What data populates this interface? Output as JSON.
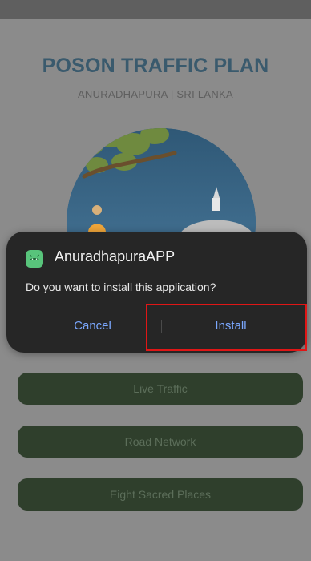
{
  "app": {
    "title": "POSON TRAFFIC PLAN",
    "subtitle": "ANURADHAPURA | SRI LANKA",
    "buttons": [
      "Live Traffic",
      "Road Network",
      "Eight Sacred Places"
    ]
  },
  "dialog": {
    "app_name": "AnuradhapuraAPP",
    "message": "Do you want to install this application?",
    "cancel_label": "Cancel",
    "install_label": "Install",
    "icon": "android-icon"
  },
  "colors": {
    "accent": "#7ba8ff",
    "dialog_bg": "#262626",
    "overlay": "#8b8b8b",
    "highlight": "#e01616"
  }
}
